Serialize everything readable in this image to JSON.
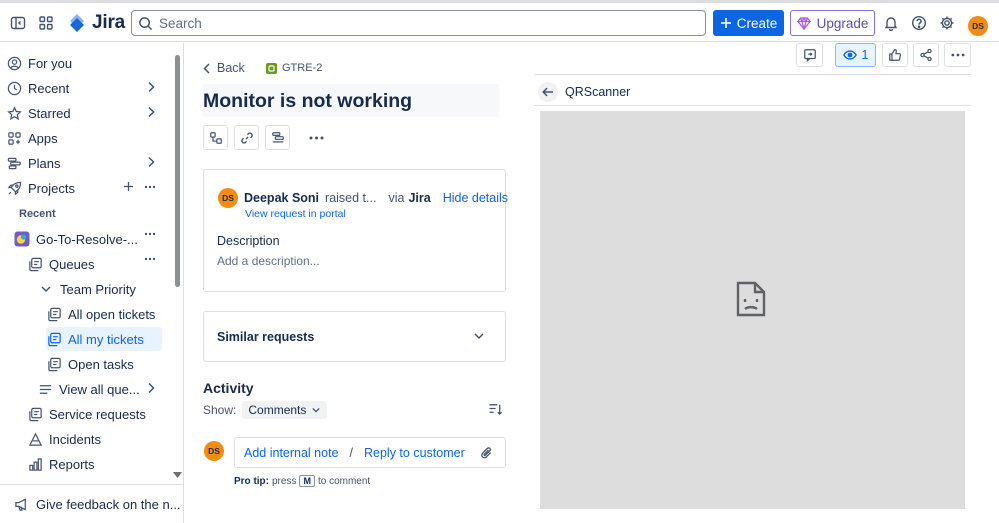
{
  "topbar": {
    "app_name": "Jira",
    "search_placeholder": "Search",
    "create_label": "Create",
    "upgrade_label": "Upgrade",
    "user_initials": "DS"
  },
  "sidebar": {
    "items": [
      {
        "label": "For you"
      },
      {
        "label": "Recent"
      },
      {
        "label": "Starred"
      },
      {
        "label": "Apps"
      },
      {
        "label": "Plans"
      },
      {
        "label": "Projects"
      }
    ],
    "recent_section": "Recent",
    "project": {
      "label": "Go-To-Resolve-..."
    },
    "queues": {
      "label": "Queues"
    },
    "team_priority": {
      "label": "Team Priority"
    },
    "all_open_tickets": {
      "label": "All open tickets"
    },
    "all_my_tickets": {
      "label": "All my tickets"
    },
    "open_tasks": {
      "label": "Open tasks"
    },
    "view_all_queues": {
      "label": "View all que..."
    },
    "service_requests": {
      "label": "Service requests"
    },
    "incidents": {
      "label": "Incidents"
    },
    "reports": {
      "label": "Reports"
    },
    "feedback": "Give feedback on the n..."
  },
  "issue": {
    "back_label": "Back",
    "key": "GTRE-2",
    "title": "Monitor is not working",
    "reporter_initials": "DS",
    "reporter_name": "Deepak Soni",
    "raised_text": "raised t...",
    "via_text": "via",
    "via_source": "Jira",
    "hide_details": "Hide details",
    "view_portal": "View request in portal",
    "description_label": "Description",
    "description_placeholder": "Add a description...",
    "similar_requests": "Similar requests"
  },
  "activity": {
    "heading": "Activity",
    "show_label": "Show:",
    "filter_value": "Comments",
    "commenter_initials": "DS",
    "add_internal_note": "Add internal note",
    "separator": "/",
    "reply_to_customer": "Reply to customer",
    "protip_bold": "Pro tip:",
    "protip_press": "press",
    "protip_key": "M",
    "protip_rest": "to comment"
  },
  "right_panel": {
    "watch_count": "1",
    "app_title": "QRScanner"
  },
  "colors": {
    "brand": "#0C66E4",
    "avatar": "#F18D13",
    "upgrade": "#8270DB",
    "issue_type": "#6A9A23",
    "frame_bg": "#DDDDDD"
  }
}
